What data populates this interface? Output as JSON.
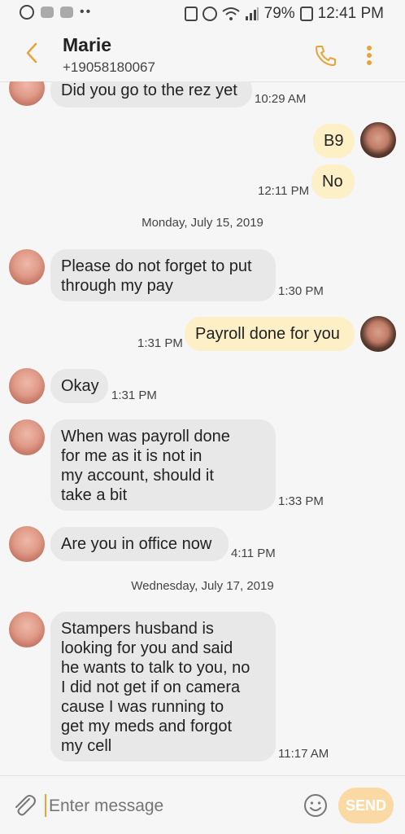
{
  "status_bar": {
    "battery": "79%",
    "time": "12:41 PM"
  },
  "header": {
    "contact_name": "Marie",
    "contact_number": "+19058180067"
  },
  "messages": [
    {
      "text": "Did you go to the rez yet",
      "time": "10:29 AM"
    },
    {
      "text": "B9",
      "time": ""
    },
    {
      "text": "No",
      "time": "12:11 PM"
    },
    {
      "text": "Please do not forget to put\nthrough my pay",
      "time": "1:30 PM"
    },
    {
      "text": "Payroll done for you",
      "time": "1:31 PM"
    },
    {
      "text": "Okay",
      "time": "1:31 PM"
    },
    {
      "text": "When was payroll done\nfor me as it is not in\nmy account, should it\ntake a bit",
      "time": "1:33 PM"
    },
    {
      "text": "Are you in office now",
      "time": "4:11 PM"
    },
    {
      "text": "Stampers husband is\nlooking for you and said\nhe wants to talk to you, no\nI did not get if on camera\ncause I was running to\nget my meds and forgot\nmy cell",
      "time": "11:17 AM"
    }
  ],
  "date_separators": [
    {
      "label": "Monday, July 15, 2019"
    },
    {
      "label": "Wednesday, July 17, 2019"
    }
  ],
  "composer": {
    "placeholder": "Enter message",
    "send_label": "SEND"
  },
  "colors": {
    "accent": "#e8a33b",
    "incoming_bubble": "#e8e8e8",
    "outgoing_bubble": "#fdefc6",
    "send_button": "#fbd9a4"
  },
  "icons": {
    "back": "chevron-left-icon",
    "call": "phone-icon",
    "more": "more-vertical-icon",
    "attach": "paperclip-icon",
    "emoji": "smiley-icon"
  }
}
